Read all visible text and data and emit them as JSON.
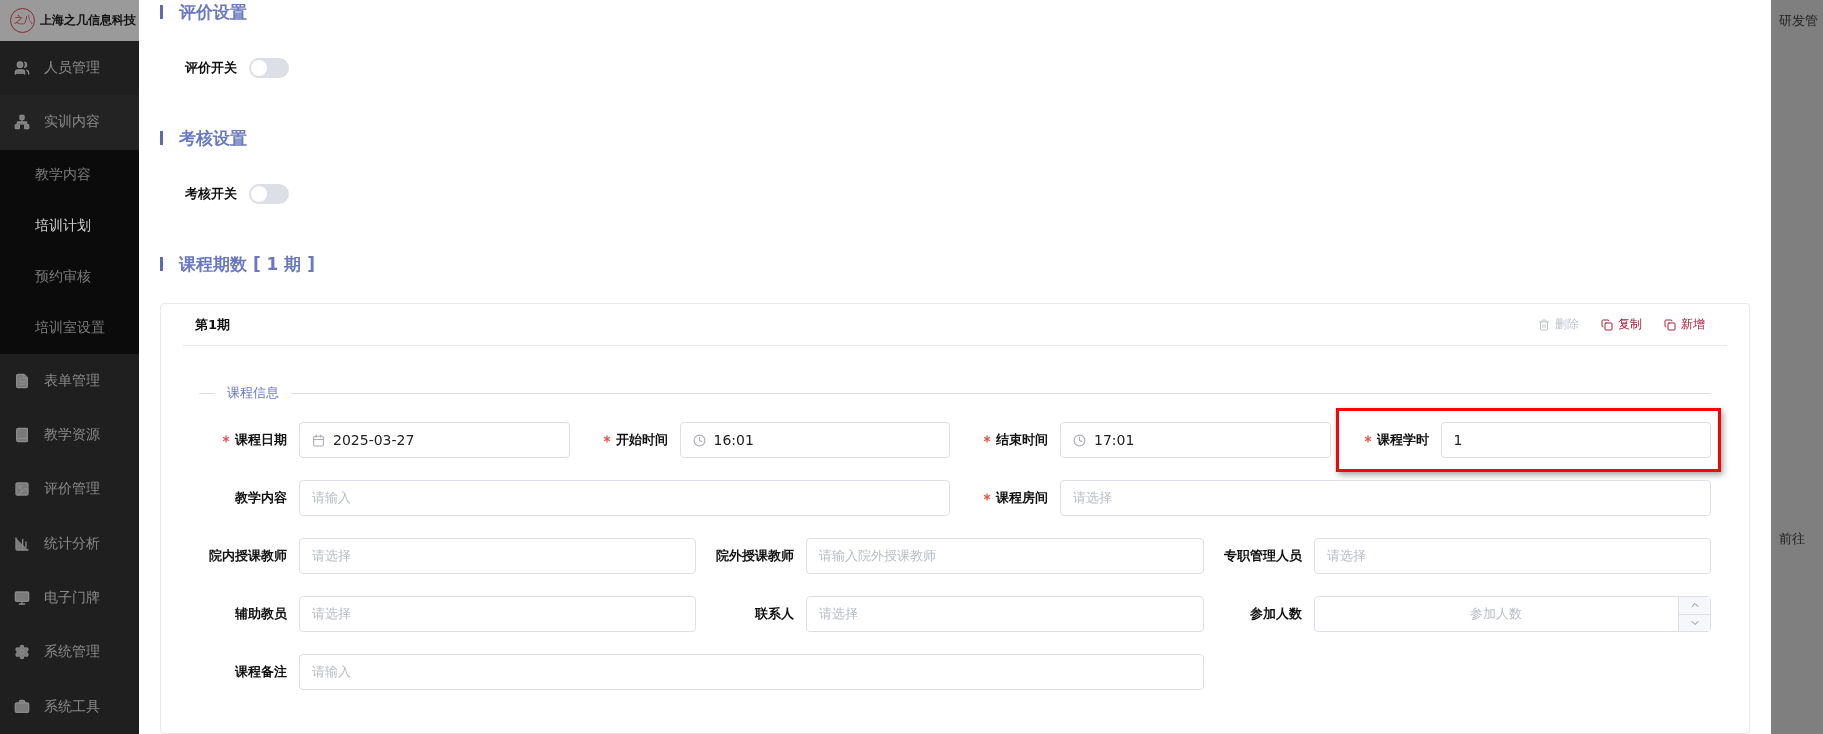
{
  "header": {
    "logo": "之八",
    "company": "上海之几信息科技"
  },
  "sidebar": {
    "items": [
      {
        "label": "人员管理",
        "expanded": false
      },
      {
        "label": "实训内容",
        "expanded": true,
        "children": [
          {
            "label": "教学内容",
            "selected": false
          },
          {
            "label": "培训计划",
            "selected": true
          },
          {
            "label": "预约审核",
            "selected": false
          },
          {
            "label": "培训室设置",
            "selected": false
          }
        ]
      },
      {
        "label": "表单管理",
        "expanded": false
      },
      {
        "label": "教学资源",
        "expanded": false
      },
      {
        "label": "评价管理",
        "expanded": false
      },
      {
        "label": "统计分析",
        "expanded": false
      },
      {
        "label": "电子门牌",
        "expanded": false
      },
      {
        "label": "系统管理",
        "expanded": false
      },
      {
        "label": "系统工具",
        "expanded": false
      }
    ]
  },
  "settings": [
    {
      "title": "评价设置",
      "switch_label": "评价开关",
      "on": false
    },
    {
      "title": "考核设置",
      "switch_label": "考核开关",
      "on": false
    }
  ],
  "periods_heading": "课程期数 [ 1 期 ]",
  "period_card": {
    "title": "第1期",
    "actions": [
      {
        "label": "删除",
        "disabled": true
      },
      {
        "label": "复制",
        "disabled": false
      },
      {
        "label": "新增",
        "disabled": false
      }
    ],
    "section": "课程信息",
    "rows": [
      [
        {
          "label": "课程日期",
          "required": true,
          "kind": "date",
          "value": "2025-03-27",
          "highlighted": false
        },
        {
          "label": "开始时间",
          "required": true,
          "kind": "time",
          "value": "16:01",
          "highlighted": false
        },
        {
          "label": "结束时间",
          "required": true,
          "kind": "time",
          "value": "17:01",
          "highlighted": false
        },
        {
          "label": "课程学时",
          "required": true,
          "kind": "text",
          "value": "1",
          "highlighted": true
        }
      ],
      [
        {
          "label": "教学内容",
          "required": false,
          "kind": "text",
          "placeholder": "请输入",
          "highlighted": false
        },
        {
          "label": "课程房间",
          "required": true,
          "kind": "select",
          "placeholder": "请选择",
          "highlighted": false
        }
      ],
      [
        {
          "label": "院内授课教师",
          "required": false,
          "kind": "select",
          "placeholder": "请选择",
          "highlighted": false
        },
        {
          "label": "院外授课教师",
          "required": false,
          "kind": "text",
          "placeholder": "请输入院外授课教师",
          "highlighted": false
        },
        {
          "label": "专职管理人员",
          "required": false,
          "kind": "select",
          "placeholder": "请选择",
          "highlighted": false
        }
      ],
      [
        {
          "label": "辅助教员",
          "required": false,
          "kind": "select",
          "placeholder": "请选择",
          "highlighted": false
        },
        {
          "label": "联系人",
          "required": false,
          "kind": "select",
          "placeholder": "请选择",
          "highlighted": false
        },
        {
          "label": "参加人数",
          "required": false,
          "kind": "number",
          "placeholder": "参加人数",
          "highlighted": false
        }
      ],
      [
        {
          "label": "课程备注",
          "required": false,
          "kind": "text",
          "placeholder": "请输入",
          "highlighted": false
        }
      ]
    ]
  },
  "backdrop": {
    "top_text": "研发管",
    "pager_text": "前往"
  }
}
